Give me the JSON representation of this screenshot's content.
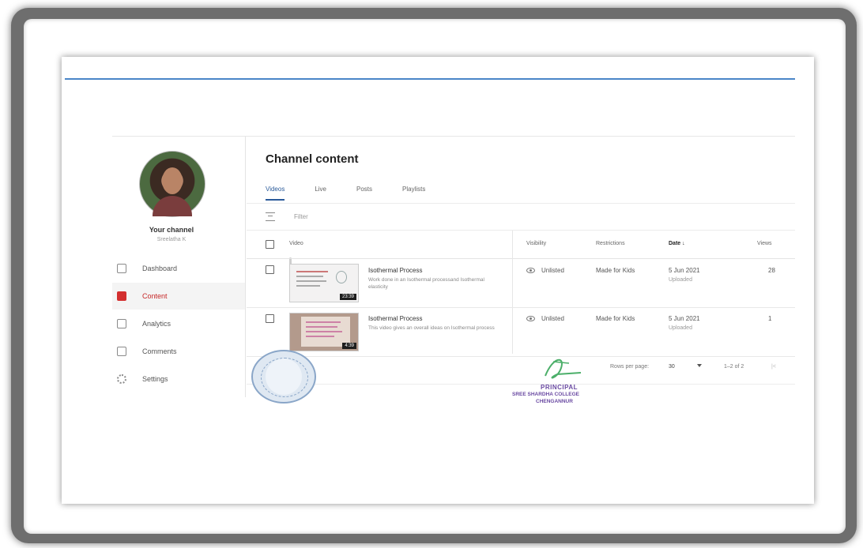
{
  "sidebar": {
    "channel_title": "Your channel",
    "channel_name": "Sreelatha K",
    "items": [
      {
        "label": "Dashboard",
        "icon": "dashboard-icon"
      },
      {
        "label": "Content",
        "icon": "content-icon",
        "active": true
      },
      {
        "label": "Analytics",
        "icon": "analytics-icon"
      },
      {
        "label": "Comments",
        "icon": "comments-icon"
      },
      {
        "label": "Settings",
        "icon": "gear-icon"
      }
    ]
  },
  "main": {
    "title": "Channel content",
    "tabs": [
      {
        "label": "Videos",
        "active": true
      },
      {
        "label": "Live"
      },
      {
        "label": "Posts"
      },
      {
        "label": "Playlists"
      }
    ],
    "filter_label": "Filter",
    "table": {
      "headers": {
        "video": "Video",
        "visibility": "Visibility",
        "restrictions": "Restrictions",
        "date": "Date ↓",
        "views": "Views"
      },
      "rows": [
        {
          "title": "Isothermal Process",
          "description": "Work done in an Isothermal processand Isothermal elasticity",
          "duration": "23:39",
          "visibility": "Unlisted",
          "restrictions": "Made for Kids",
          "date": "5 Jun 2021",
          "date_status": "Uploaded",
          "views": "28"
        },
        {
          "title": "Isothermal Process",
          "description": "This video gives an overall ideas on Isothermal process",
          "duration": "4:39",
          "visibility": "Unlisted",
          "restrictions": "Made for Kids",
          "date": "5 Jun 2021",
          "date_status": "Uploaded",
          "views": "1"
        }
      ]
    },
    "pagination": {
      "rows_per_page_label": "Rows per page:",
      "rows_per_page_value": "30",
      "range": "1–2 of 2",
      "first_page": "|<"
    }
  },
  "signature": {
    "line1": "PRINCIPAL",
    "line2": "SREE SHARDHA COLLEGE",
    "line3": "CHENGANNUR"
  },
  "colors": {
    "accent": "#2a5a9a",
    "active_nav": "#c62828",
    "top_line": "#4a86c8",
    "stamp": "#6a4aa2"
  }
}
